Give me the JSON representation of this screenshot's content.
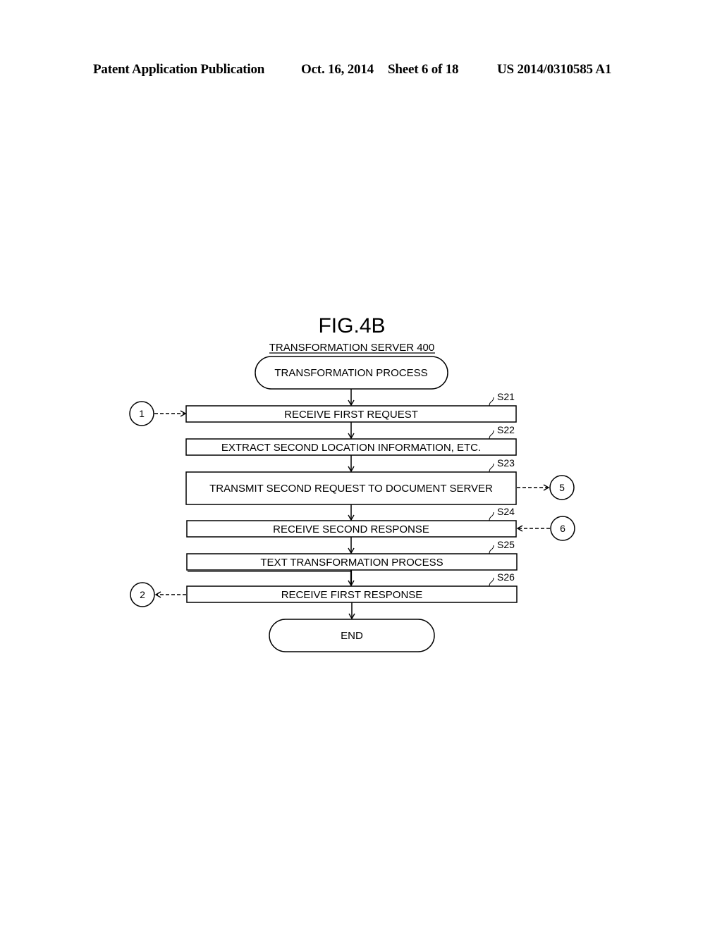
{
  "header": {
    "publication": "Patent Application Publication",
    "date": "Oct. 16, 2014",
    "sheet": "Sheet 6 of 18",
    "patent_number": "US 2014/0310585 A1"
  },
  "figure": {
    "title": "FIG.4B",
    "subtitle": "TRANSFORMATION SERVER 400",
    "start": "TRANSFORMATION PROCESS",
    "end": "END",
    "steps": [
      {
        "id": "S21",
        "text": "RECEIVE FIRST REQUEST"
      },
      {
        "id": "S22",
        "text": "EXTRACT SECOND LOCATION INFORMATION, ETC."
      },
      {
        "id": "S23",
        "text": "TRANSMIT SECOND REQUEST TO DOCUMENT SERVER"
      },
      {
        "id": "S24",
        "text": "RECEIVE SECOND RESPONSE"
      },
      {
        "id": "S25",
        "text": "TEXT TRANSFORMATION PROCESS"
      },
      {
        "id": "S26",
        "text": "RECEIVE FIRST RESPONSE"
      }
    ],
    "connectors": [
      {
        "label": "1",
        "step": "S21",
        "direction": "in"
      },
      {
        "label": "5",
        "step": "S23",
        "direction": "out"
      },
      {
        "label": "6",
        "step": "S24",
        "direction": "in"
      },
      {
        "label": "2",
        "step": "S26",
        "direction": "out"
      }
    ]
  }
}
